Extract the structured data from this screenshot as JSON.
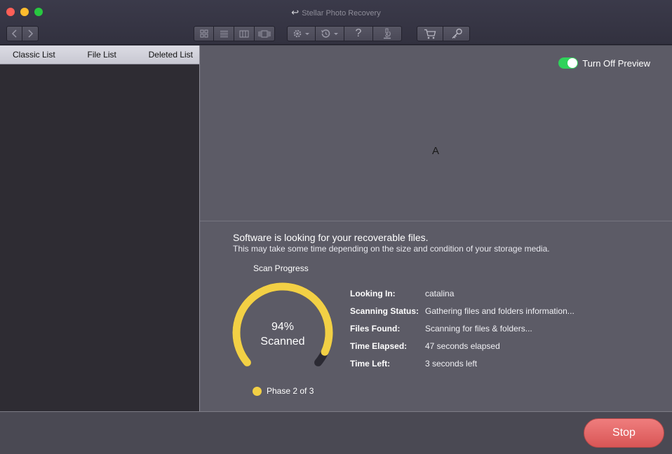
{
  "window": {
    "title": "Stellar Photo Recovery",
    "title_icon": "back-arrow-icon"
  },
  "toolbar": {
    "nav": [
      {
        "icon": "chevron-left-icon"
      },
      {
        "icon": "chevron-right-icon"
      }
    ],
    "views": [
      {
        "icon": "grid-view-icon"
      },
      {
        "icon": "list-view-icon"
      },
      {
        "icon": "column-view-icon"
      },
      {
        "icon": "coverflow-view-icon"
      }
    ],
    "actions": [
      {
        "icon": "gear-icon"
      },
      {
        "icon": "history-icon"
      },
      {
        "icon": "help-icon",
        "glyph": "?"
      },
      {
        "icon": "microscope-icon"
      }
    ],
    "store": [
      {
        "icon": "cart-icon"
      },
      {
        "icon": "key-icon"
      }
    ]
  },
  "tabs": [
    "Classic List",
    "File List",
    "Deleted List"
  ],
  "preview": {
    "toggle_label": "Turn Off Preview",
    "toggle_on": true,
    "toggle_color": "#2fd25a",
    "placeholder_glyph": "A"
  },
  "scan": {
    "title": "Software is looking for your recoverable files.",
    "subtitle": "This may take some time depending on the size and condition of your storage media.",
    "progress_label": "Scan Progress",
    "progress_percent": 94,
    "percent_text": "94%",
    "scanned_text": "Scanned",
    "gauge_color": "#f2d045",
    "phase_label": "Phase 2 of 3",
    "details": [
      {
        "key": "Looking In:",
        "value": "catalina"
      },
      {
        "key": "Scanning Status:",
        "value": "Gathering files and folders information..."
      },
      {
        "key": "Files Found:",
        "value": "Scanning for files & folders..."
      },
      {
        "key": "Time Elapsed:",
        "value": "47 seconds elapsed"
      },
      {
        "key": "Time Left:",
        "value": "3 seconds left"
      }
    ]
  },
  "footer": {
    "stop_label": "Stop",
    "stop_color": "#e06363"
  }
}
